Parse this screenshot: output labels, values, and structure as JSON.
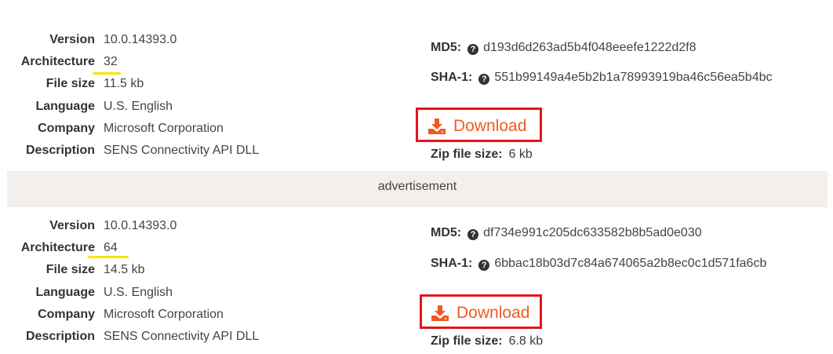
{
  "files": [
    {
      "details": [
        {
          "label": "Version",
          "value": "10.0.14393.0"
        },
        {
          "label": "Architecture",
          "value": "32"
        },
        {
          "label": "File size",
          "value": "11.5 kb"
        },
        {
          "label": "Language",
          "value": "U.S. English"
        },
        {
          "label": "Company",
          "value": "Microsoft Corporation"
        },
        {
          "label": "Description",
          "value": "SENS Connectivity API DLL"
        }
      ],
      "md5_label": "MD5:",
      "md5": "d193d6d263ad5b4f048eeefe1222d2f8",
      "sha1_label": "SHA-1:",
      "sha1": "551b99149a4e5b2b1a78993919ba46c56ea5b4bc",
      "download_label": "Download",
      "zip_label": "Zip file size:",
      "zip_size": "6 kb"
    },
    {
      "details": [
        {
          "label": "Version",
          "value": "10.0.14393.0"
        },
        {
          "label": "Architecture",
          "value": "64"
        },
        {
          "label": "File size",
          "value": "14.5 kb"
        },
        {
          "label": "Language",
          "value": "U.S. English"
        },
        {
          "label": "Company",
          "value": "Microsoft Corporation"
        },
        {
          "label": "Description",
          "value": "SENS Connectivity API DLL"
        }
      ],
      "md5_label": "MD5:",
      "md5": "df734e991c205dc633582b8b5ad0e030",
      "sha1_label": "SHA-1:",
      "sha1": "6bbac18b03d7c84a674065a2b8ec0c1d571fa6cb",
      "download_label": "Download",
      "zip_label": "Zip file size:",
      "zip_size": "6.8 kb"
    }
  ],
  "advertisement": "advertisement",
  "icons": {
    "help": "help-circle-icon",
    "download": "download-tray-icon"
  },
  "colors": {
    "accent": "#f05a22",
    "highlight_box": "#e3141c",
    "underline": "#f5e600",
    "ad_background": "#f2efec"
  }
}
